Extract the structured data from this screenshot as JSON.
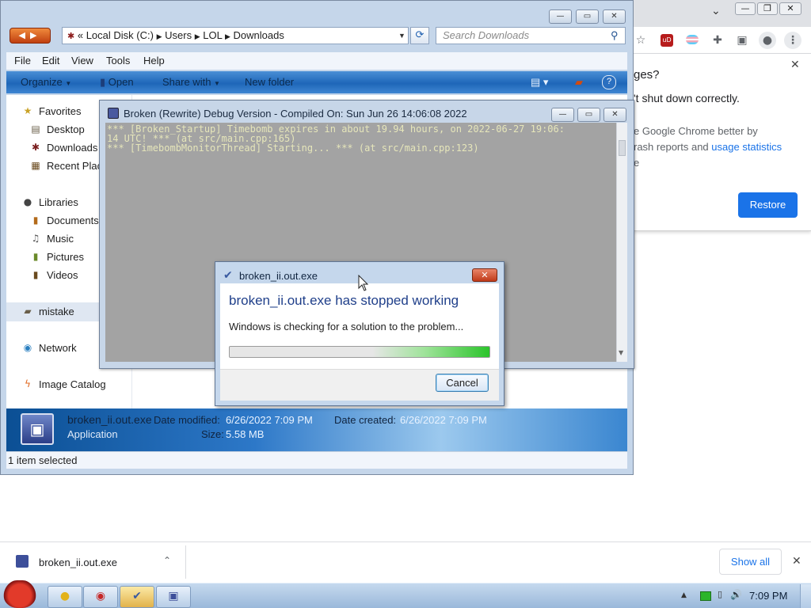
{
  "chrome": {
    "prompt_title_partial": "ges?",
    "prompt_message_partial": "'t shut down correctly.",
    "prompt_detail_line1": "e Google Chrome better by",
    "prompt_detail_line2_prefix": "rash reports and ",
    "prompt_detail_link": "usage statistics",
    "prompt_detail_line3": "e",
    "restore_label": "Restore",
    "close_glyph": "✕",
    "window_controls": [
      "⌄",
      "—",
      "❐",
      "✕"
    ],
    "toolbar_icons": [
      "star-icon",
      "extension-ud-icon",
      "extension-flag-icon",
      "puzzle-icon",
      "sidepanel-icon",
      "profile-icon",
      "menu-icon"
    ]
  },
  "explorer": {
    "breadcrumb": [
      "«",
      "Local Disk (C:)",
      "Users",
      "LOL",
      "Downloads"
    ],
    "search_placeholder": "Search Downloads",
    "menu": [
      "File",
      "Edit",
      "View",
      "Tools",
      "Help"
    ],
    "commands": {
      "organize": "Organize",
      "open": "Open",
      "share_with": "Share with",
      "new_folder": "New folder"
    },
    "nav": {
      "favorites": "Favorites",
      "desktop": "Desktop",
      "downloads": "Downloads",
      "recent_places": "Recent Plac",
      "libraries": "Libraries",
      "documents": "Documents",
      "music": "Music",
      "pictures": "Pictures",
      "videos": "Videos",
      "mistake": "mistake",
      "network": "Network",
      "image_catalog": "Image Catalog"
    },
    "details": {
      "filename": "broken_ii.out.exe",
      "type": "Application",
      "date_modified_label": "Date modified:",
      "date_modified": "6/26/2022 7:09 PM",
      "date_created_label": "Date created:",
      "date_created": "6/26/2022 7:09 PM",
      "size_label": "Size:",
      "size": "5.58 MB"
    },
    "status": "1 item selected"
  },
  "debug_window": {
    "title": "Broken (Rewrite) Debug Version - Compiled On: Sun Jun 26 14:06:08 2022",
    "lines": [
      "*** [Broken_Startup] Timebomb expires in about 19.94 hours, on 2022-06-27 19:06:",
      "14 UTC! *** (at src/main.cpp:165)",
      "*** [TimebombMonitorThread] Starting... *** (at src/main.cpp:123)"
    ]
  },
  "error_dialog": {
    "title": "broken_ii.out.exe",
    "heading": "broken_ii.out.exe has stopped working",
    "message": "Windows is checking for a solution to the problem...",
    "progress": 1.0,
    "cancel_label": "Cancel"
  },
  "download_shelf": {
    "filename": "broken_ii.out.exe",
    "show_all_label": "Show all"
  },
  "taskbar": {
    "time": "7:09 PM"
  },
  "colors": {
    "chrome_accent": "#1a73e8",
    "dialog_heading": "#1f3f8a",
    "console_text": "#e6e6ba",
    "console_bg": "#a3a3a3",
    "progress_green": "#2bc42b"
  }
}
